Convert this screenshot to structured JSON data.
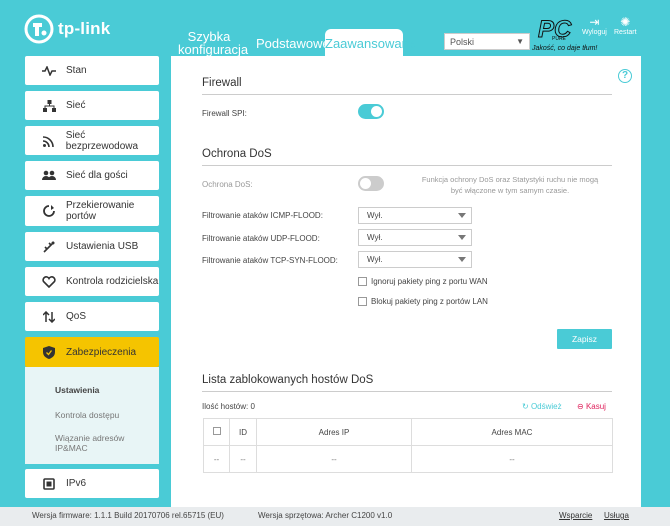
{
  "brand": {
    "logo_text": "tp-link"
  },
  "top_nav": {
    "quick": "Szybka konfiguracja",
    "basic": "Podstawowe",
    "advanced": "Zaawansowane",
    "language": "Polski",
    "logout": "Wyloguj",
    "reboot": "Restart"
  },
  "watermark": {
    "pc": "PC",
    "slogan": "Jakość, co daje tłum!",
    "tiny": "PURE"
  },
  "sidebar": {
    "items": [
      {
        "label": "Stan",
        "icon": "status-icon"
      },
      {
        "label": "Sieć",
        "icon": "network-icon"
      },
      {
        "label": "Sieć bezprzewodowa",
        "icon": "wireless-icon"
      },
      {
        "label": "Sieć dla gości",
        "icon": "guest-network-icon"
      },
      {
        "label": "Przekierowanie portów",
        "icon": "nat-forwarding-icon"
      },
      {
        "label": "Ustawienia USB",
        "icon": "usb-icon"
      },
      {
        "label": "Kontrola rodzicielska",
        "icon": "parental-control-icon"
      },
      {
        "label": "QoS",
        "icon": "qos-icon"
      },
      {
        "label": "Zabezpieczenia",
        "icon": "security-shield-icon"
      },
      {
        "label": "IPv6",
        "icon": "ipv6-icon"
      }
    ],
    "subitems": [
      "Ustawienia",
      "Kontrola dostępu",
      "Wiązanie adresów IP&MAC"
    ]
  },
  "firewall": {
    "title": "Firewall",
    "spi_label": "Firewall SPI:",
    "spi_enabled": true
  },
  "dos": {
    "title": "Ochrona DoS",
    "label": "Ochrona DoS:",
    "enabled": false,
    "note": "Funkcja ochrony DoS oraz Statystyki ruchu nie mogą być włączone w tym samym czasie.",
    "icmp_label": "Filtrowanie ataków ICMP-FLOOD:",
    "icmp_value": "Wył.",
    "udp_label": "Filtrowanie ataków UDP-FLOOD:",
    "udp_value": "Wył.",
    "tcp_label": "Filtrowanie ataków TCP-SYN-FLOOD:",
    "tcp_value": "Wył.",
    "ignore_wan": "Ignoruj pakiety ping z portu WAN",
    "block_lan": "Blokuj pakiety ping z portów LAN",
    "save": "Zapisz"
  },
  "blocked": {
    "title": "Lista zablokowanych hostów DoS",
    "count_label": "Ilość hostów: 0",
    "refresh": "Odśwież",
    "delete": "Kasuj",
    "columns": [
      "",
      "ID",
      "Adres IP",
      "Adres MAC"
    ],
    "row": [
      "--",
      "--",
      "--",
      "--"
    ]
  },
  "footer": {
    "firmware": "Wersja firmware: 1.1.1 Build 20170706 rel.65715 (EU)",
    "hardware": "Wersja sprzętowa: Archer C1200 v1.0",
    "support": "Wsparcie",
    "service": "Usługa"
  },
  "colors": {
    "accent": "#4acbd6",
    "active": "#f5c400",
    "delete": "#e0245e"
  }
}
